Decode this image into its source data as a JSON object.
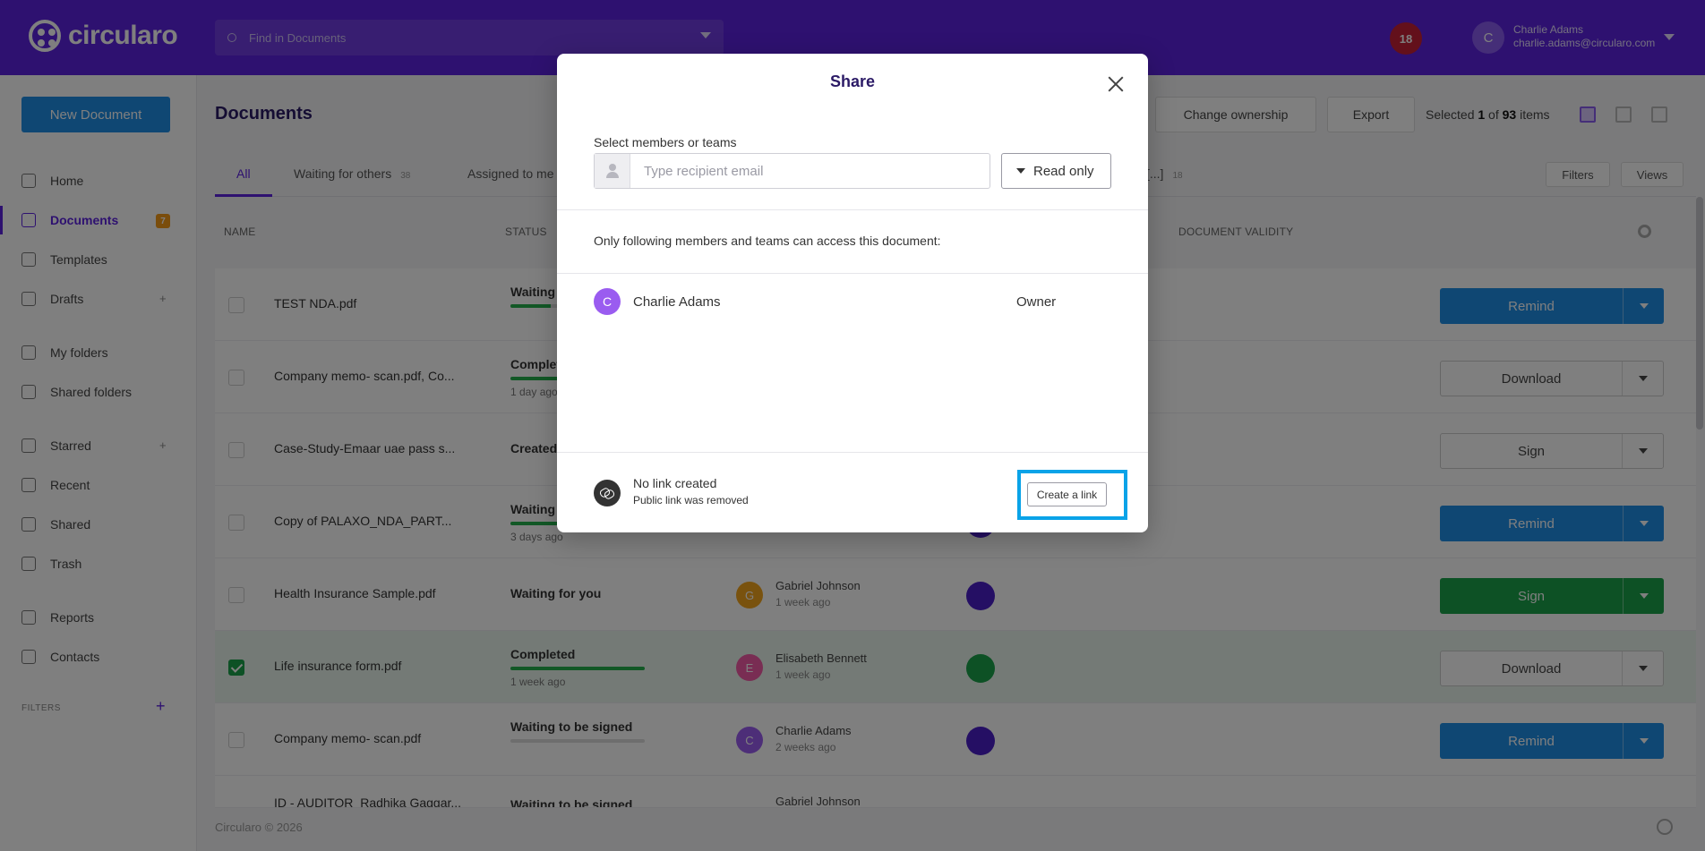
{
  "app": {
    "logo_text": "circularo",
    "search_placeholder": "Find in Documents",
    "notification_count": "18"
  },
  "user": {
    "initial": "C",
    "name": "Charlie Adams",
    "email": "charlie.adams@circularo.com"
  },
  "sidebar": {
    "new_document": "New Document",
    "items": [
      {
        "label": "Home"
      },
      {
        "label": "Documents",
        "badge": "7"
      },
      {
        "label": "Templates"
      },
      {
        "label": "Drafts"
      },
      {
        "label": "My folders"
      },
      {
        "label": "Shared folders"
      },
      {
        "label": "Starred"
      },
      {
        "label": "Recent"
      },
      {
        "label": "Shared"
      },
      {
        "label": "Trash"
      },
      {
        "label": "Reports"
      },
      {
        "label": "Contacts"
      }
    ],
    "filters_label": "FILTERS"
  },
  "main": {
    "title": "Documents",
    "toolbar": {
      "change_ownership": "Change ownership",
      "export": "Export",
      "selected_prefix": "Selected ",
      "selected_count": "1",
      "selected_mid": " of ",
      "total_count": "93",
      "selected_suffix": " items"
    },
    "tabs": [
      {
        "label": "All"
      },
      {
        "label": "Waiting for others",
        "count": "38"
      },
      {
        "label": "Assigned to me"
      },
      {
        "label": "[...]",
        "count": "18"
      }
    ],
    "filters_btn": "Filters",
    "views_btn": "Views",
    "columns": {
      "name": "NAME",
      "status": "STATUS",
      "validity": "DOCUMENT VALIDITY"
    },
    "rows": [
      {
        "name": "TEST NDA.pdf",
        "status": "Waiting",
        "action": "Remind",
        "progress": 0.3
      },
      {
        "name": "Company memo- scan.pdf, Co...",
        "status": "Completed",
        "sub": "1 day ago",
        "action": "Download",
        "progress": 1
      },
      {
        "name": "Case-Study-Emaar uae pass s...",
        "status": "Created",
        "action": "Sign"
      },
      {
        "name": "Copy of PALAXO_NDA_PART...",
        "status": "Waiting",
        "sub": "3 days ago",
        "action": "Remind",
        "progress": 0.5
      },
      {
        "name": "Health Insurance Sample.pdf",
        "status": "Waiting for you",
        "creator_initial": "G",
        "creator": "Gabriel Johnson",
        "creator_time": "1 week ago",
        "action": "Sign"
      },
      {
        "name": "Life insurance form.pdf",
        "status": "Completed",
        "sub": "1 week ago",
        "creator_initial": "E",
        "creator": "Elisabeth Bennett",
        "creator_time": "1 week ago",
        "action": "Download",
        "progress": 1
      },
      {
        "name": "Company memo- scan.pdf",
        "status": "Waiting to be signed",
        "creator_initial": "C",
        "creator": "Charlie Adams",
        "creator_time": "2 weeks ago",
        "action": "Remind",
        "progress": 0
      },
      {
        "name": "ID - AUDITOR_Radhika Gaggar...",
        "status": "Waiting to be signed",
        "creator": "Gabriel Johnson"
      }
    ],
    "footer": "Circularo © 2026"
  },
  "modal": {
    "title": "Share",
    "select_label": "Select members or teams",
    "recipient_placeholder": "Type recipient email",
    "permission": "Read only",
    "access_text": "Only following members and teams can access this document:",
    "members": [
      {
        "initial": "C",
        "name": "Charlie Adams",
        "role": "Owner"
      }
    ],
    "link_title": "No link created",
    "link_subtitle": "Public link was removed",
    "create_link": "Create a link"
  },
  "colors": {
    "brand": "#5d22e0",
    "primary": "#1e8ee6",
    "success": "#1aa34a",
    "highlight": "#0aa3e8"
  }
}
